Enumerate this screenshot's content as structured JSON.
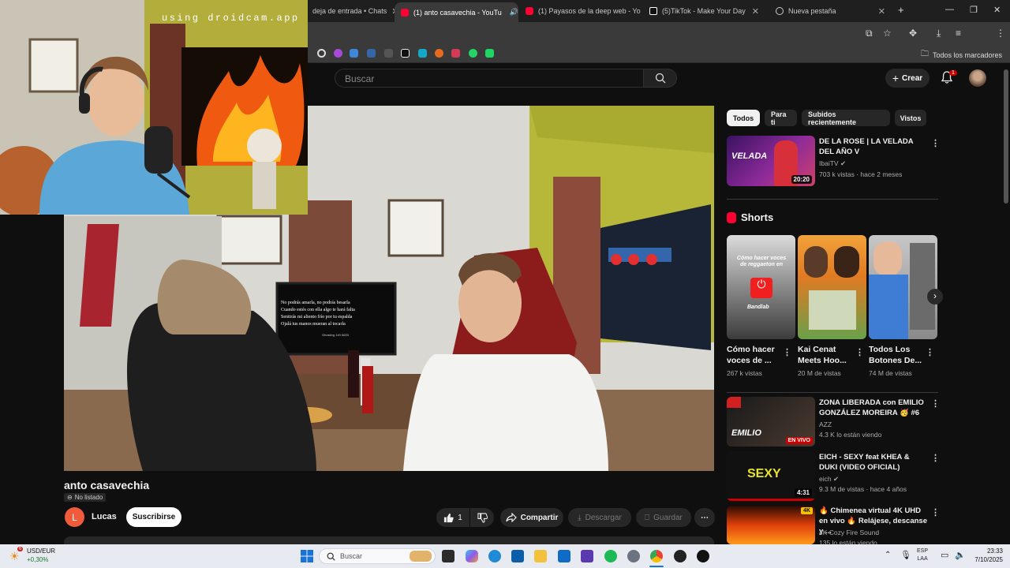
{
  "browser": {
    "tabs": [
      {
        "label": "deja de entrada • Chats",
        "favicon": "mail-icon"
      },
      {
        "label": "(1) anto casavechia - YouTu",
        "favicon": "youtube-icon",
        "active": true
      },
      {
        "label": "(1) Payasos de la deep web - Yo",
        "favicon": "youtube-icon"
      },
      {
        "label": "(5)TikTok - Make Your Day",
        "favicon": "tiktok-icon"
      },
      {
        "label": "Nueva pestaña",
        "favicon": "globe-icon"
      }
    ],
    "bookmarks_all": "Todos los marcadores"
  },
  "webcam": {
    "watermark": "using droidcam.app"
  },
  "header": {
    "search_placeholder": "Buscar",
    "create_label": "Crear",
    "notification_count": "1"
  },
  "video": {
    "overlay_text_lines": [
      "No podrás amarla, no podrás besarla",
      "Cuando estés con ella algo te hará falta",
      "Sentirás mi aliento frío por tu espalda",
      "Ojalá tus manos mueran al tocarla"
    ],
    "overlay_caption": "Ghosting 140 6000",
    "title": "anto casavechia",
    "visibility": "No listado",
    "channel_initial": "L",
    "channel_name": "Lucas",
    "subscribe_label": "Suscribirse",
    "likes": "1",
    "share_label": "Compartir",
    "download_label": "Descargar",
    "save_label": "Guardar"
  },
  "filters": [
    "Todos",
    "Para ti",
    "Subidos recientemente",
    "Vistos"
  ],
  "recommended_top": {
    "title": "DE LA ROSE | LA VELADA DEL AÑO V",
    "channel": "IbaiTV",
    "meta": "703 k vistas · hace 2 meses",
    "duration": "20:20",
    "thumb_text": "VELADA"
  },
  "shorts": {
    "heading": "Shorts",
    "items": [
      {
        "title": "Cómo hacer voces de ...",
        "views": "267 k vistas",
        "thumb_text": "Cómo hacer voces de reggaeton en",
        "badge": "Bandlab"
      },
      {
        "title": "Kai Cenat Meets Hoo...",
        "views": "20 M de vistas"
      },
      {
        "title": "Todos Los Botones De...",
        "views": "74 M de vistas"
      }
    ]
  },
  "recommended_more": [
    {
      "title": "ZONA LIBERADA con EMILIO GONZÁLEZ MOREIRA 🥳 #6",
      "channel": "AZZ",
      "meta": "4.3 K lo están viendo",
      "thumb_text": "EMILIO",
      "badge": "EN VIVO"
    },
    {
      "title": "EICH - SEXY feat KHEA & DUKI (VIDEO OFICIAL)",
      "channel": "eich",
      "meta": "9.3 M de vistas · hace 4 años",
      "duration": "4:31",
      "thumb_text": "SEXY"
    },
    {
      "title": "🔥 Chimenea virtual 4K UHD en vivo 🔥 Relájese, descanse y ...",
      "channel": "4K Cozy Fire Sound",
      "meta": "135 lo están viendo",
      "badge": "4K"
    }
  ],
  "taskbar": {
    "ticker_symbol": "USD/EUR",
    "ticker_change": "+0,30%",
    "weather_badge": "6",
    "search_label": "Buscar",
    "lang_top": "ESP",
    "lang_bottom": "LAA",
    "time": "23:33",
    "date": "7/10/2025"
  }
}
